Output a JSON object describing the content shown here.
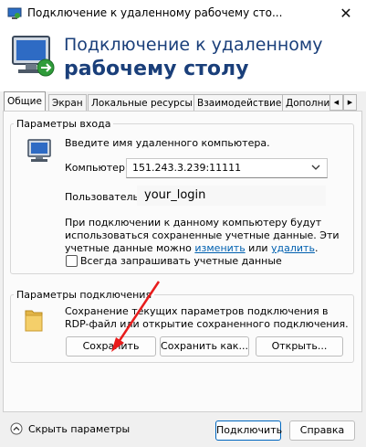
{
  "window": {
    "title": "Подключение к удаленному рабочему сто...",
    "close_glyph": "✕"
  },
  "header": {
    "line1": "Подключение к удаленному",
    "line2": "рабочему столу"
  },
  "tabs": [
    {
      "label": "Общие"
    },
    {
      "label": "Экран"
    },
    {
      "label": "Локальные ресурсы"
    },
    {
      "label": "Взаимодействие"
    },
    {
      "label": "Дополни"
    }
  ],
  "tab_scroll": {
    "left": "◀",
    "right": "▶"
  },
  "login_group": {
    "title": "Параметры входа",
    "hint": "Введите имя удаленного компьютера.",
    "computer_label": "Компьютер:",
    "computer_value": "151.243.3.239:11111",
    "user_label": "Пользователь:",
    "user_value": "your_login",
    "info_line1": "При подключении к данному компьютеру будут",
    "info_line2": "использоваться сохраненные учетные данные.  Эти",
    "info_line3_pre": "учетные данные можно",
    "info_link_edit": "изменить",
    "info_mid": "или",
    "info_link_delete": "удалить",
    "info_dot": ".",
    "always_ask_label": "Всегда запрашивать учетные данные",
    "always_ask_checked": false
  },
  "conn_group": {
    "title": "Параметры подключения",
    "desc_line1": "Сохранение текущих параметров подключения в",
    "desc_line2": "RDP-файл или открытие сохраненного подключения.",
    "save_button": "Сохранить",
    "save_as_button": "Сохранить как...",
    "open_button": "Открыть..."
  },
  "footer": {
    "hide_params": "Скрыть параметры",
    "connect_button": "Подключить",
    "help_button": "Справка"
  },
  "colors": {
    "accent": "#0067c0",
    "header_text": "#1a3f7a",
    "annotation_arrow": "#e81c1c"
  }
}
